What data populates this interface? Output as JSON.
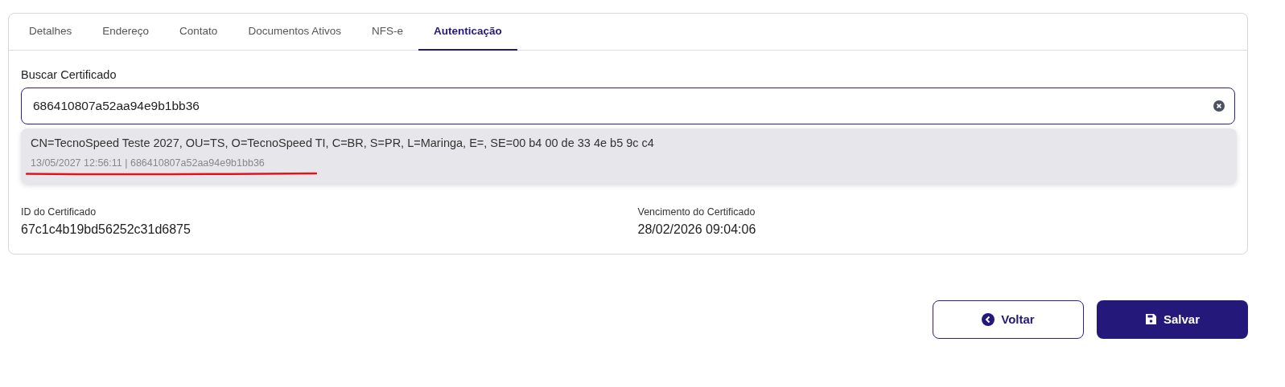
{
  "tabs": [
    {
      "label": "Detalhes",
      "selected": false
    },
    {
      "label": "Endereço",
      "selected": false
    },
    {
      "label": "Contato",
      "selected": false
    },
    {
      "label": "Documentos Ativos",
      "selected": false
    },
    {
      "label": "NFS-e",
      "selected": false
    },
    {
      "label": "Autenticação",
      "selected": true
    }
  ],
  "search": {
    "label": "Buscar Certificado",
    "value": "686410807a52aa94e9b1bb36"
  },
  "suggestions": [
    {
      "title": "CN=TecnoSpeed Teste 2027, OU=TS, O=TecnoSpeed TI, C=BR, S=PR, L=Maringa, E=, SE=00 b4 00 de 33 4e b5 9c c4",
      "detail": "13/05/2027 12:56:11 | 686410807a52aa94e9b1bb36",
      "underlined": true,
      "highlighted": true
    }
  ],
  "fields": [
    {
      "label": "ID do Certificado",
      "value": "67c1c4b19bd56252c31d6875"
    },
    {
      "label": "Vencimento do Certificado",
      "value": "28/02/2026 09:04:06"
    }
  ],
  "buttons": [
    {
      "label": "Voltar",
      "kind": "back"
    },
    {
      "label": "Salvar",
      "kind": "save"
    }
  ]
}
